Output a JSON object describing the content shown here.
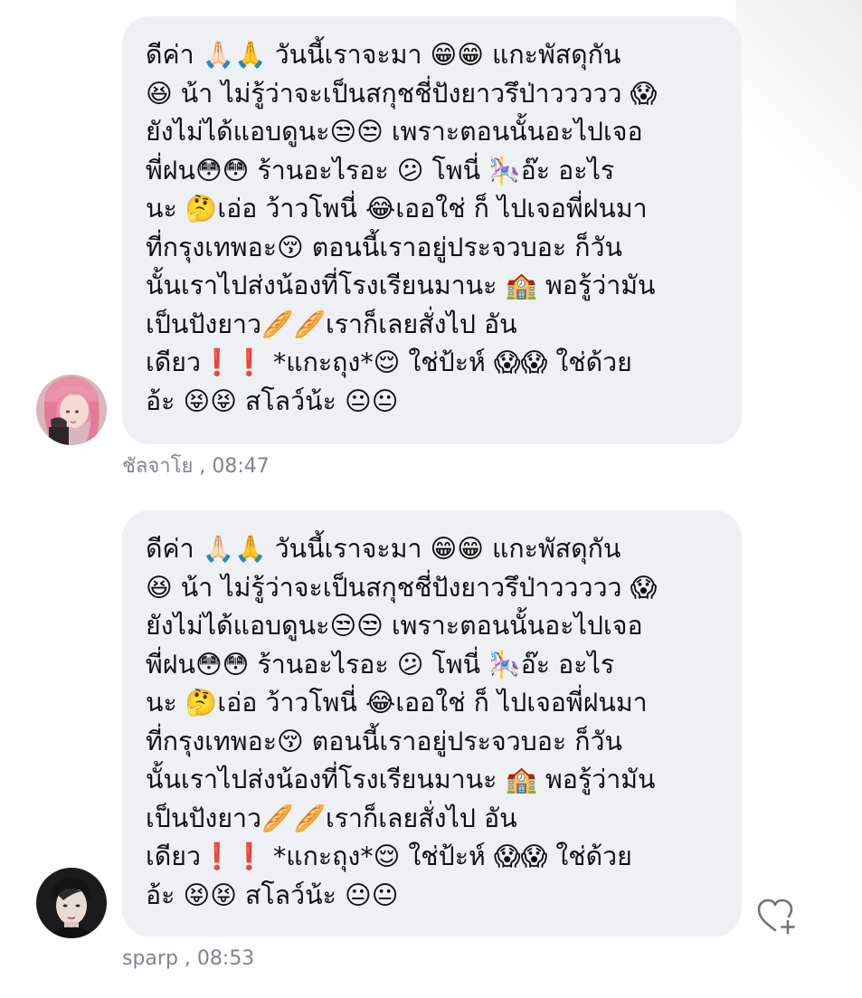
{
  "messages": [
    {
      "sender": "ชัลจาโย",
      "time": ", 08:47",
      "lines": [
        "ดีค่า 🙏🏻🙏 วันนี้เราจะมา 😁😁 แกะพัสดุกัน",
        "😆 น้า ไม่รู้ว่าจะเป็นสกุชชี่ปังยาวรึป่าววววว 😱",
        "ยังไม่ได้แอบดูนะ😒😒 เพราะตอนนั้นอะไปเจอ",
        "พี่ฝน😳😳 ร้านอะไรอะ 😕 โพนี่ 🎠อ๊ะ อะไร",
        "นะ 🤔เอ่อ ว้าวโพนี่ 😂เออใช่ ก็ ไปเจอพี่ฝนมา",
        "ที่กรุงเทพอะ😚 ตอนนี้เราอยู่ประจวบอะ ก็วัน",
        "นั้นเราไปส่งน้องที่โรงเรียนมานะ 🏫 พอรู้ว่ามัน",
        "เป็นปังยาว🥖🥖เราก็เลยสั่งไป อัน",
        "เดียว❗❗ *แกะถุง*😌 ใช่ป้ะห์ 😱😱 ใช่ด้วย",
        "อ้ะ 😝😝 สโลว์น้ะ 😐😐"
      ]
    },
    {
      "sender": "sparp",
      "time": ", 08:53",
      "lines": [
        "ดีค่า 🙏🏻🙏 วันนี้เราจะมา 😁😁 แกะพัสดุกัน",
        "😆 น้า ไม่รู้ว่าจะเป็นสกุชชี่ปังยาวรึป่าววววว 😱",
        "ยังไม่ได้แอบดูนะ😒😒 เพราะตอนนั้นอะไปเจอ",
        "พี่ฝน😳😳 ร้านอะไรอะ 😕 โพนี่ 🎠อ๊ะ อะไร",
        "นะ 🤔เอ่อ ว้าวโพนี่ 😂เออใช่ ก็ ไปเจอพี่ฝนมา",
        "ที่กรุงเทพอะ😚 ตอนนี้เราอยู่ประจวบอะ ก็วัน",
        "นั้นเราไปส่งน้องที่โรงเรียนมานะ 🏫 พอรู้ว่ามัน",
        "เป็นปังยาว🥖🥖เราก็เลยสั่งไป อัน",
        "เดียว❗❗ *แกะถุง*😌 ใช่ป้ะห์ 😱😱 ใช่ด้วย",
        "อ้ะ 😝😝 สโลว์น้ะ 😐😐"
      ]
    }
  ],
  "icons": {
    "avatar_1": "avatar-pink-hair",
    "avatar_2": "avatar-dark-hair",
    "like": "heart-plus-icon"
  },
  "colors": {
    "bubble_background": "#eef1f3",
    "meta_text": "#7e858c",
    "message_text": "#111111"
  }
}
